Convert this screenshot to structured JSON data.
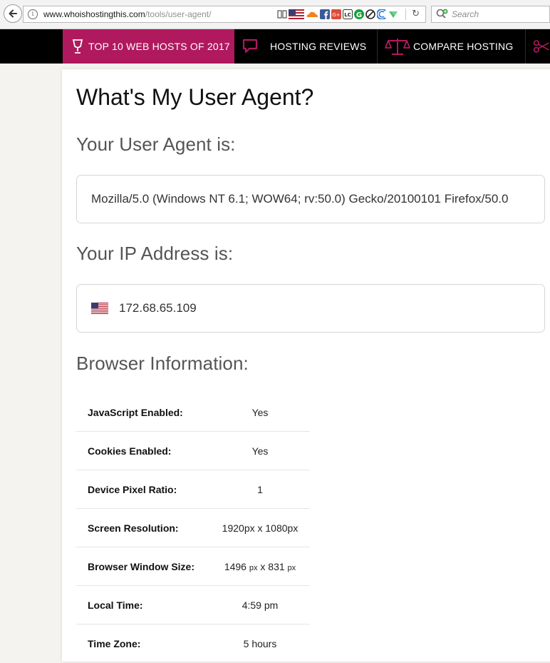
{
  "browser": {
    "url_host": "www.whoishostingthis.com",
    "url_path": "/tools/user-agent/",
    "search_placeholder": "Search"
  },
  "nav": {
    "items": [
      {
        "label": "TOP 10 WEB HOSTS OF 2017",
        "icon": "trophy-icon",
        "active": true
      },
      {
        "label": "HOSTING REVIEWS",
        "icon": "speech-bubble-icon",
        "active": false
      },
      {
        "label": "COMPARE HOSTING",
        "icon": "scales-icon",
        "active": false
      },
      {
        "label": "",
        "icon": "scissors-icon",
        "active": false
      }
    ],
    "active_color": "#b0195e",
    "icon_color": "#b0195e"
  },
  "main": {
    "title": "What's My User Agent?",
    "user_agent_heading": "Your User Agent is:",
    "user_agent": "Mozilla/5.0 (Windows NT 6.1; WOW64; rv:50.0) Gecko/20100101 Firefox/50.0",
    "ip_heading": "Your IP Address is:",
    "ip_address": "172.68.65.109",
    "ip_flag": "us-flag-icon",
    "browser_info_heading": "Browser Information:",
    "browser_info": [
      {
        "label": "JavaScript Enabled:",
        "value": "Yes"
      },
      {
        "label": "Cookies Enabled:",
        "value": "Yes"
      },
      {
        "label": "Device Pixel Ratio:",
        "value": "1"
      },
      {
        "label": "Screen Resolution:",
        "value": "1920px x 1080px"
      },
      {
        "label": "Browser Window Size:",
        "value_parts": [
          "1496",
          "px",
          "x",
          "831",
          "px"
        ]
      },
      {
        "label": "Local Time:",
        "value": "4:59 pm"
      },
      {
        "label": "Time Zone:",
        "value": "5 hours"
      }
    ]
  }
}
